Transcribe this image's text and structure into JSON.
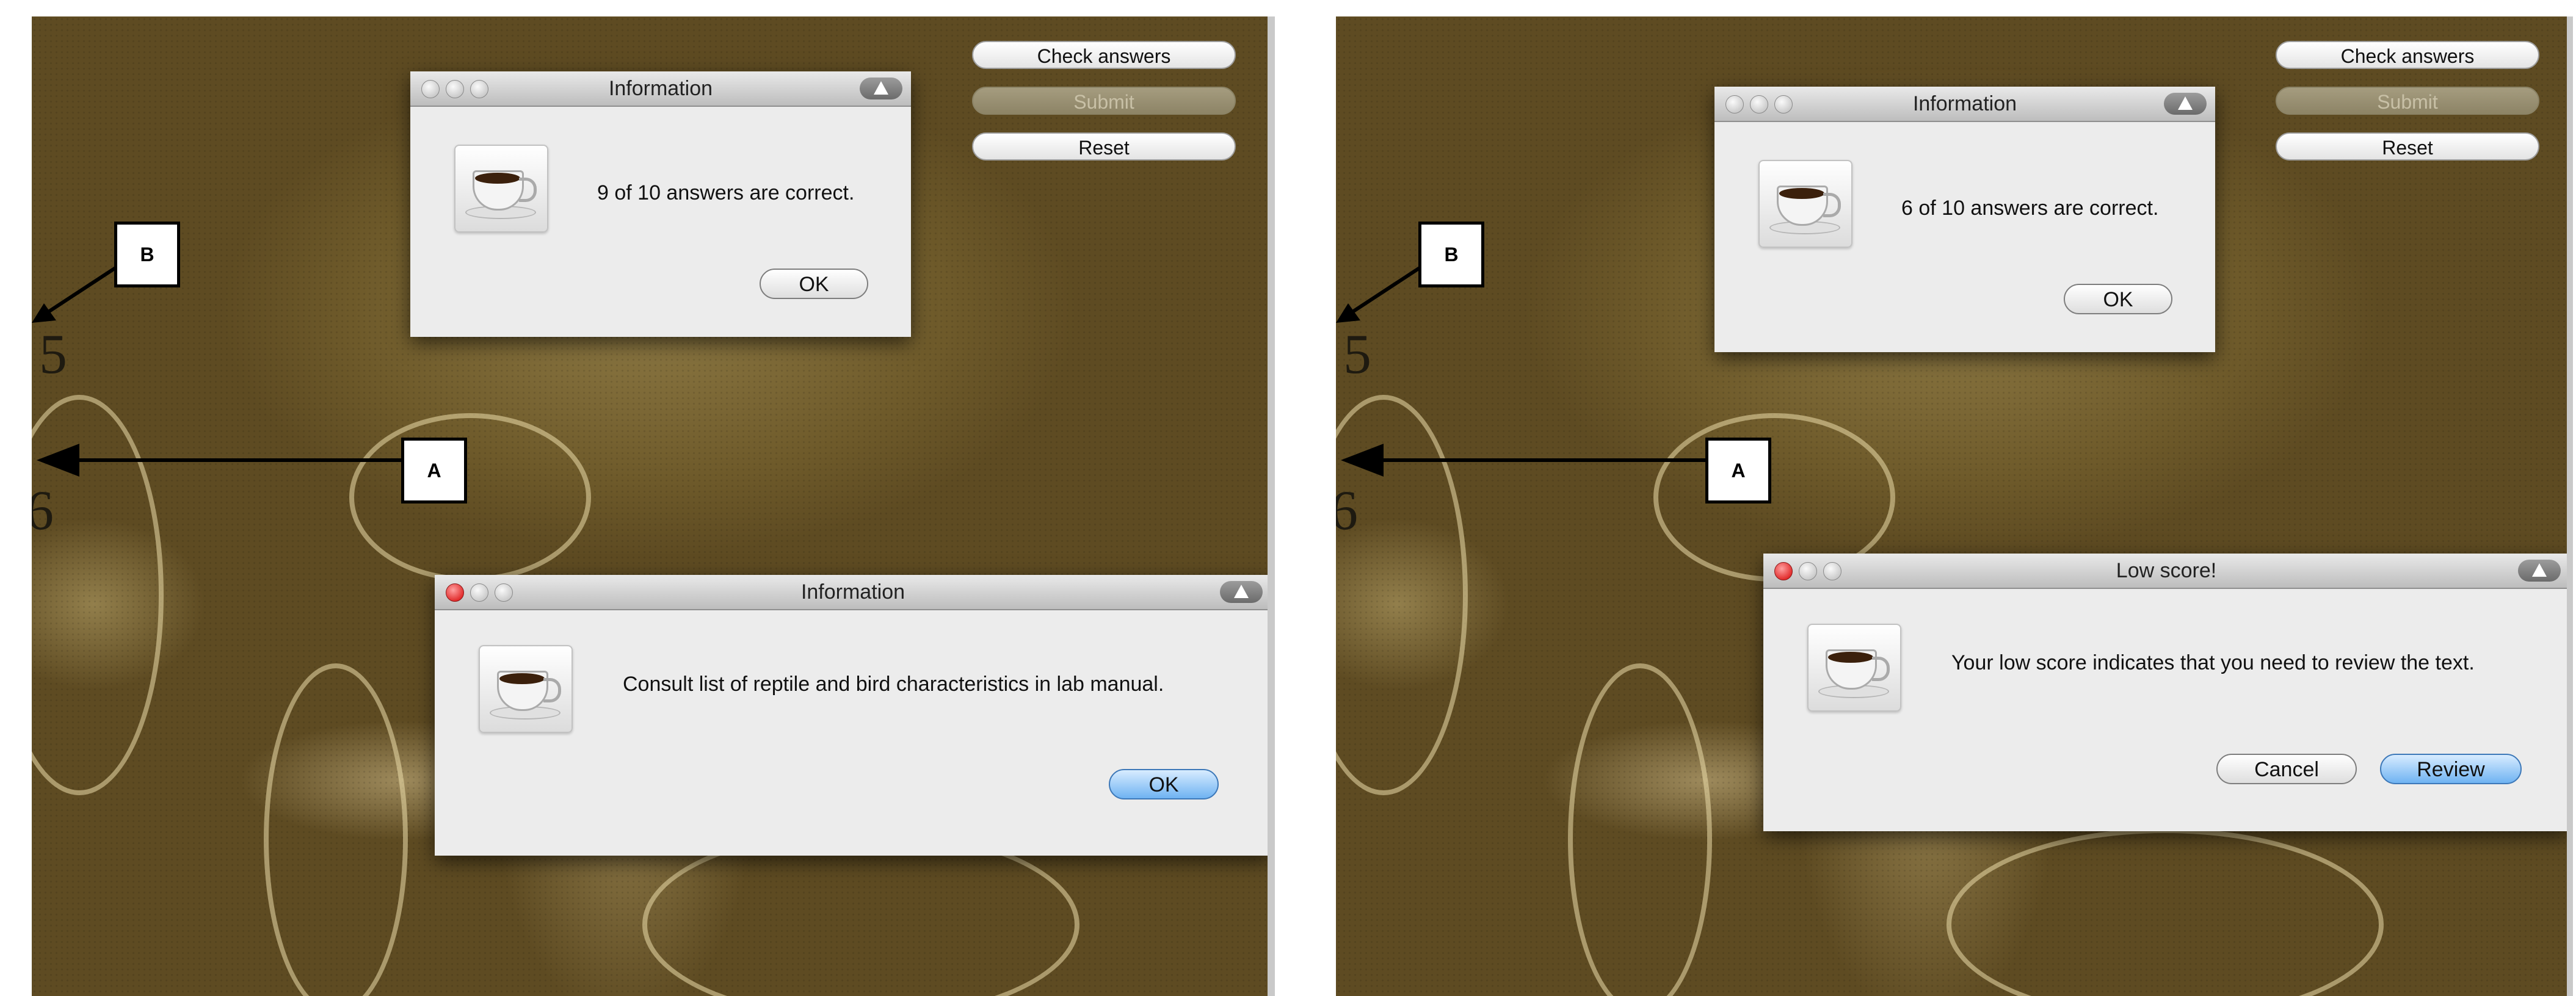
{
  "controls": {
    "check_answers": "Check answers",
    "submit": "Submit",
    "reset": "Reset"
  },
  "callouts": {
    "a": "A",
    "b": "B"
  },
  "axis_numbers": {
    "five": "5",
    "six": "6"
  },
  "left_panel": {
    "top_dialog": {
      "title": "Information",
      "message": "9 of 10 answers are correct.",
      "ok": "OK"
    },
    "bottom_dialog": {
      "title": "Information",
      "message": "Consult list of reptile and bird characteristics in lab manual.",
      "ok": "OK"
    }
  },
  "right_panel": {
    "top_dialog": {
      "title": "Information",
      "message": "6 of 10 answers are correct.",
      "ok": "OK"
    },
    "bottom_dialog": {
      "title": "Low score!",
      "message": "Your low score indicates that you need to review the text.",
      "cancel": "Cancel",
      "review": "Review"
    }
  },
  "colors": {
    "accent_button": "#6fb3f2",
    "close_button": "#d60000",
    "fossil_background": "#7a6633"
  },
  "icons": [
    "coffee-cup-icon",
    "warning-icon"
  ]
}
